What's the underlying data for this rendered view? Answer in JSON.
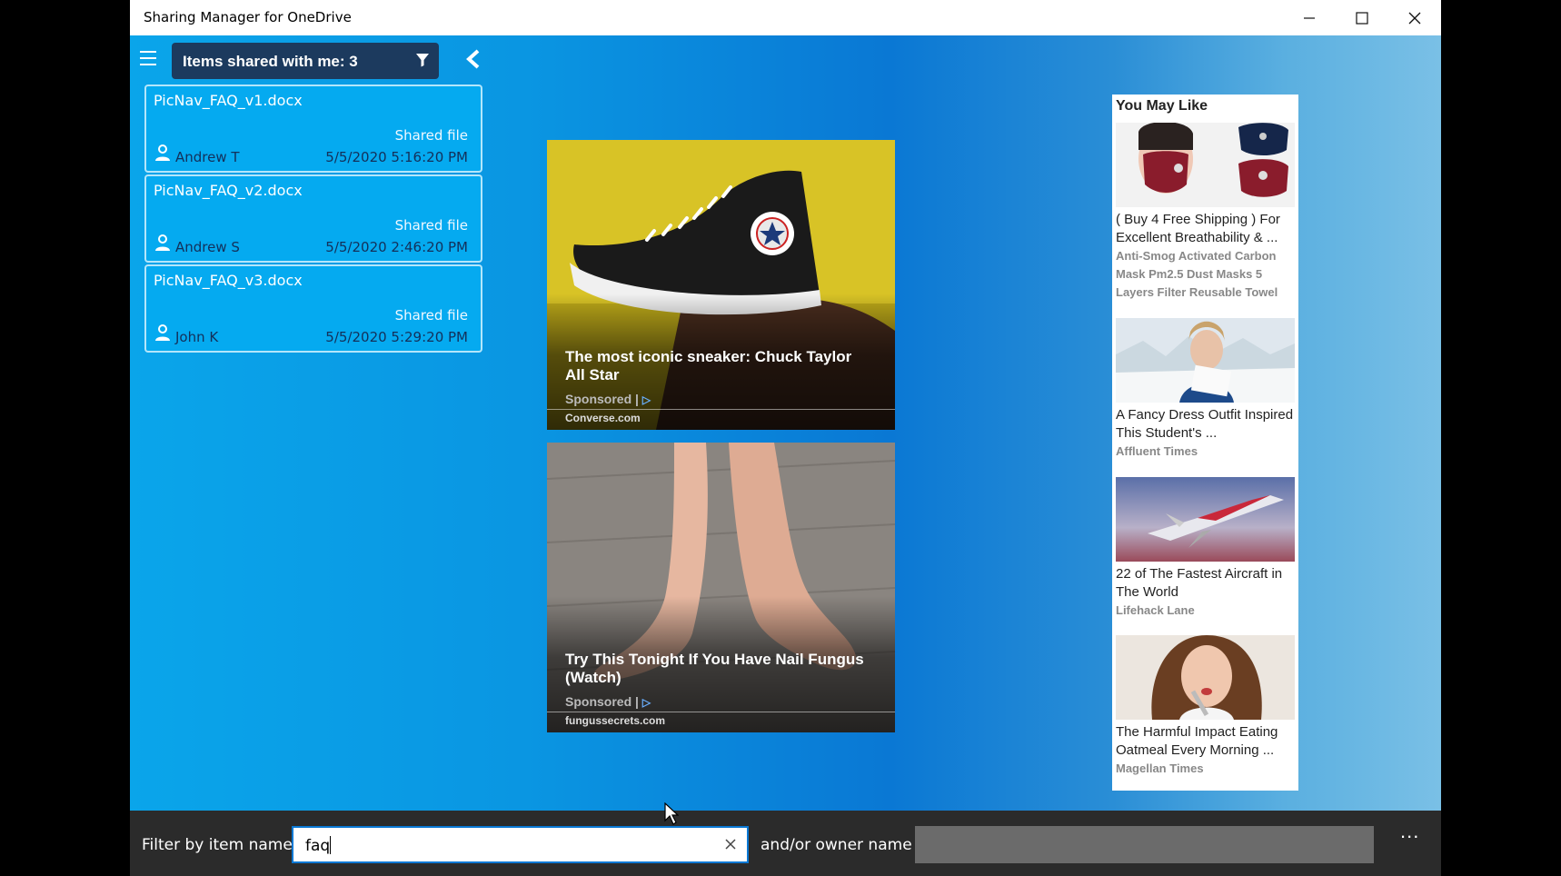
{
  "window": {
    "title": "Sharing Manager for OneDrive"
  },
  "header": {
    "label": "Items shared with me: 3"
  },
  "items": [
    {
      "name": "PicNav_FAQ_v1.docx",
      "type": "Shared file",
      "owner": "Andrew T",
      "date": "5/5/2020 5:16:20 PM"
    },
    {
      "name": "PicNav_FAQ_v2.docx",
      "type": "Shared file",
      "owner": "Andrew S",
      "date": "5/5/2020 2:46:20 PM"
    },
    {
      "name": "PicNav_FAQ_v3.docx",
      "type": "Shared file",
      "owner": "John K",
      "date": "5/5/2020 5:29:20 PM"
    }
  ],
  "ads": [
    {
      "headline": "The most iconic sneaker: Chuck Taylor All Star",
      "sponsored": "Sponsored",
      "source": "Converse.com"
    },
    {
      "headline": "Try This Tonight If You Have Nail Fungus (Watch)",
      "sponsored": "Sponsored",
      "source": "fungussecrets.com"
    }
  ],
  "side_ad": {
    "heading": "You May Like",
    "items": [
      {
        "title": "( Buy 4 Free Shipping ) For Excellent Breathability & ...",
        "source": "Anti-Smog Activated Carbon Mask Pm2.5 Dust Masks 5 Layers Filter Reusable Towel"
      },
      {
        "title": "A Fancy Dress Outfit Inspired This Student's ...",
        "source": "Affluent Times"
      },
      {
        "title": "22 of The Fastest Aircraft in The World",
        "source": "Lifehack Lane"
      },
      {
        "title": "The Harmful Impact Eating Oatmeal Every Morning ...",
        "source": "Magellan Times"
      }
    ]
  },
  "footer": {
    "item_label": "Filter by item name",
    "item_value": "faq",
    "owner_label": "and/or owner name",
    "owner_value": "",
    "more": "..."
  }
}
